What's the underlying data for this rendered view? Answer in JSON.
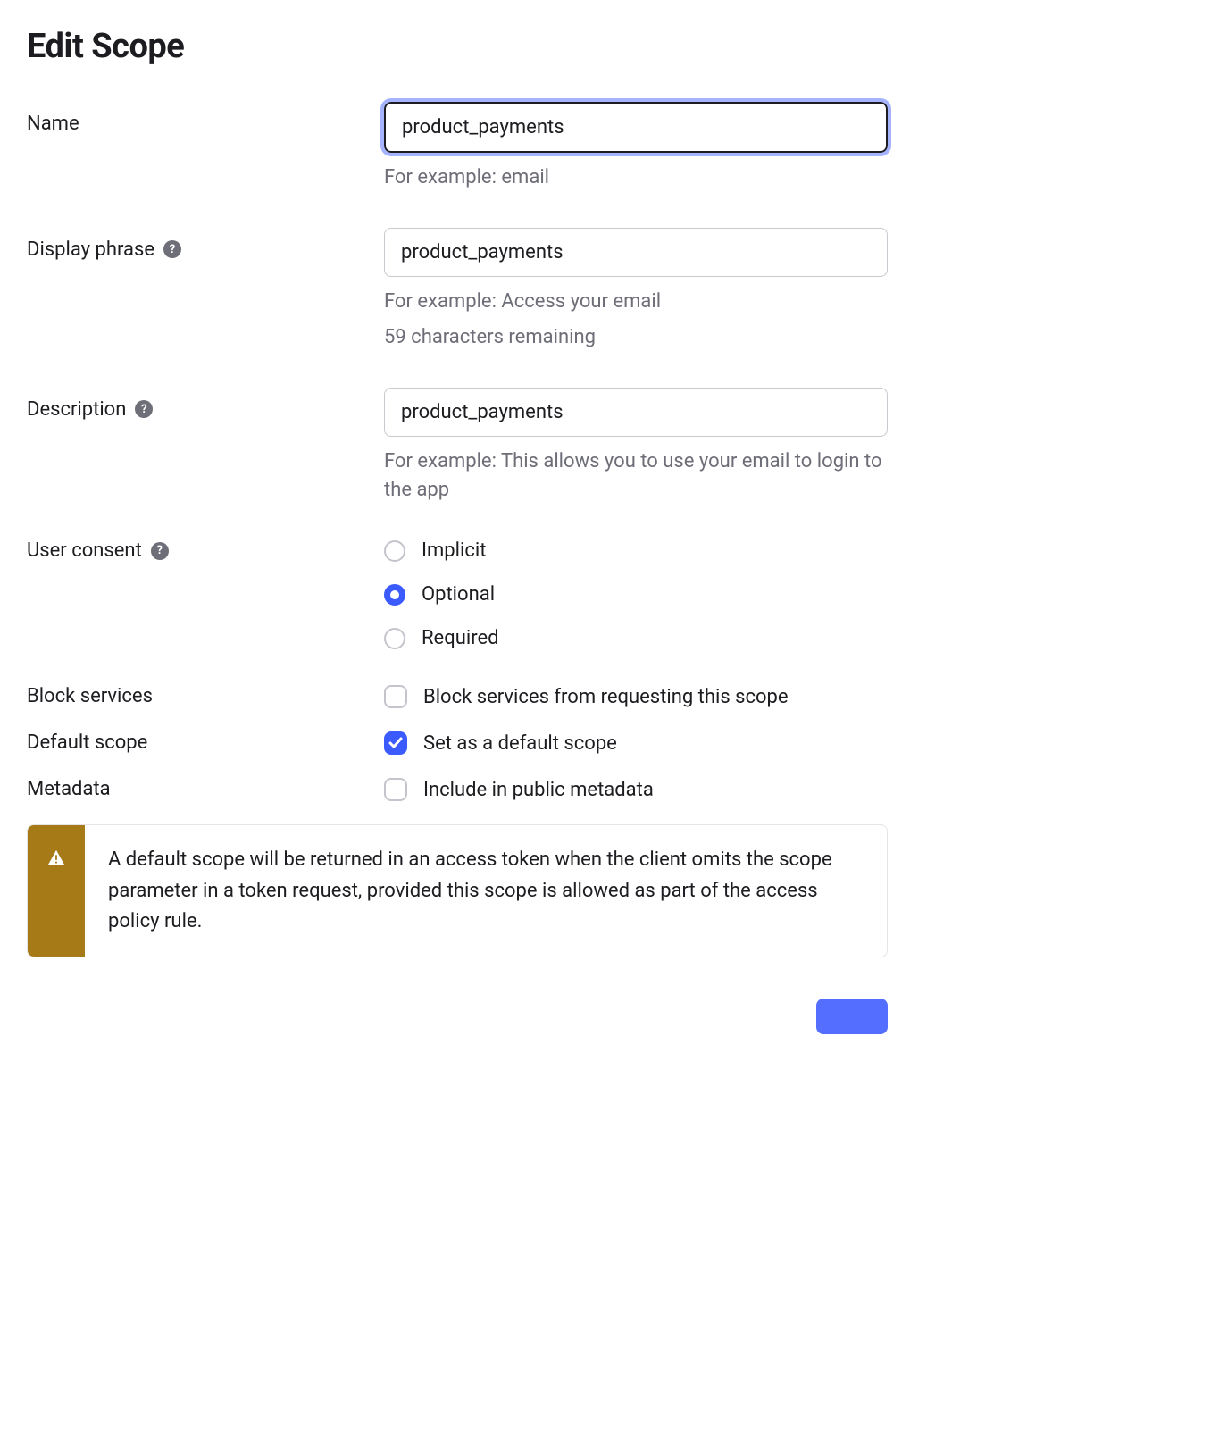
{
  "title": "Edit Scope",
  "fields": {
    "name": {
      "label": "Name",
      "value": "product_payments",
      "hint": "For example: email"
    },
    "display_phrase": {
      "label": "Display phrase",
      "value": "product_payments",
      "hint": "For example: Access your email",
      "counter": "59 characters remaining"
    },
    "description": {
      "label": "Description",
      "value": "product_payments",
      "hint": "For example: This allows you to use your email to login to the app"
    },
    "user_consent": {
      "label": "User consent",
      "selected": "Optional",
      "options": [
        "Implicit",
        "Optional",
        "Required"
      ]
    },
    "block_services": {
      "label": "Block services",
      "checkbox_label": "Block services from requesting this scope",
      "checked": false
    },
    "default_scope": {
      "label": "Default scope",
      "checkbox_label": "Set as a default scope",
      "checked": true
    },
    "metadata": {
      "label": "Metadata",
      "checkbox_label": "Include in public metadata",
      "checked": false
    }
  },
  "alert": {
    "text": "A default scope will be returned in an access token when the client omits the scope parameter in a token request, provided this scope is allowed as part of the access policy rule."
  }
}
